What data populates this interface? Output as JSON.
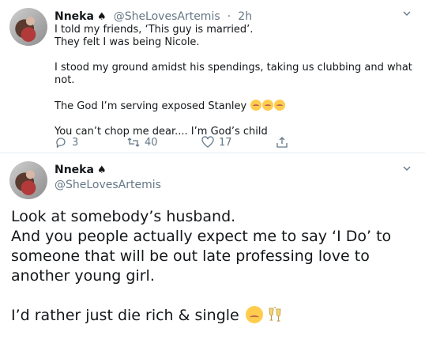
{
  "tweet1": {
    "name": "Nneka",
    "name_symbol": "♠",
    "handle": "@SheLovesArtemis",
    "dot": "·",
    "time": "2h",
    "lines": [
      "I told my friends, ‘This guy is married’.",
      "They felt I was being Nicole.",
      "I stood my ground amidst his spendings, taking us clubbing and what not.",
      "The God I’m serving exposed Stanley",
      "You can’t chop me dear.... I’m God’s child"
    ],
    "emoji_count": 3,
    "actions": {
      "replies": "3",
      "retweets": "40",
      "likes": "17"
    },
    "icons": [
      "reply-icon",
      "retweet-icon",
      "like-icon",
      "share-icon",
      "chevron-down-icon"
    ]
  },
  "tweet2": {
    "name": "Nneka",
    "name_symbol": "♠",
    "handle": "@SheLovesArtemis",
    "lines": [
      "Look at somebody’s husband.",
      "And you people actually expect me to say ‘I Do’ to",
      "someone that will be out late professing love to",
      "another young girl.",
      "I’d rather just die rich & single"
    ],
    "emojis": [
      "smiling-face-icon",
      "clinking-glasses-icon"
    ]
  },
  "colors": {
    "text": "#14171a",
    "secondary": "#657786",
    "divider": "#e6ecf0",
    "emoji": "#ffcc4d"
  }
}
